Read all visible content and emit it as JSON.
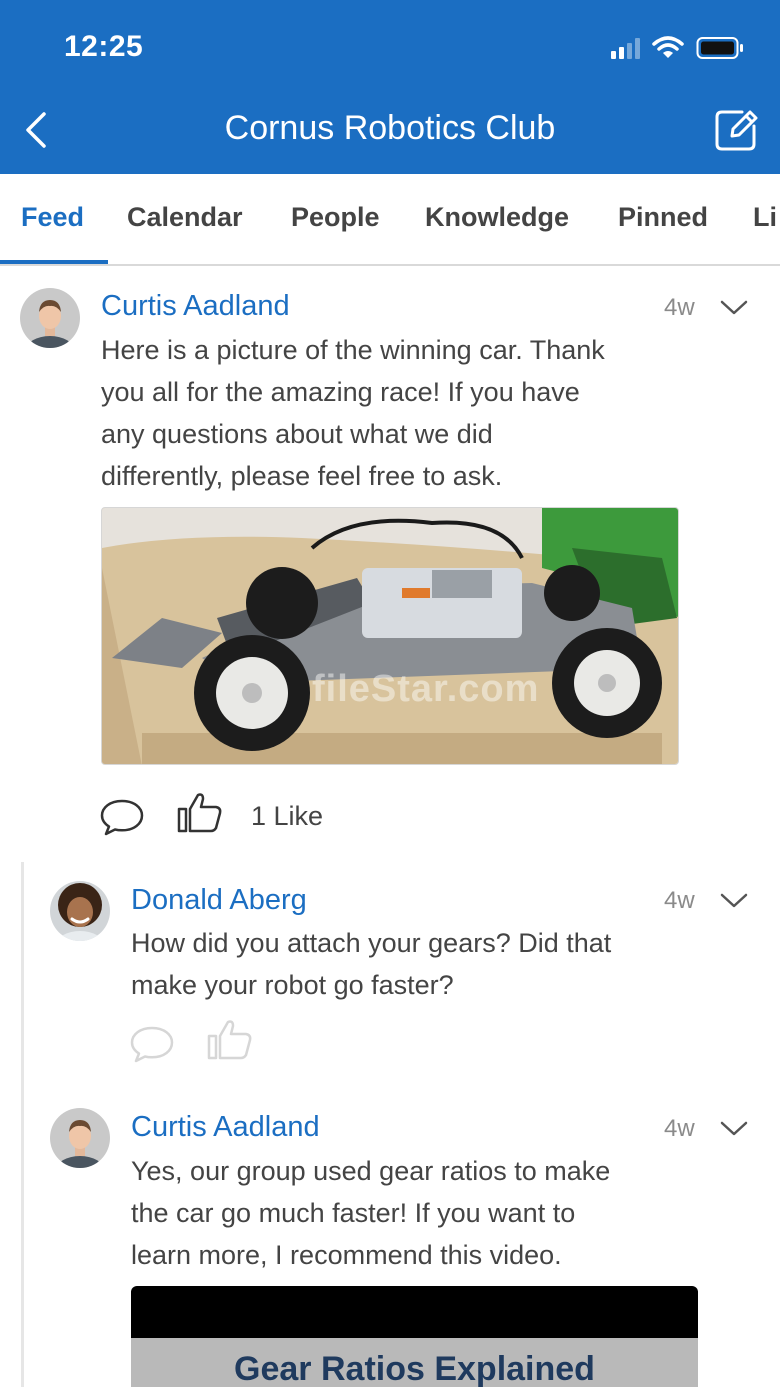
{
  "status_bar": {
    "time": "12:25"
  },
  "header": {
    "title": "Cornus Robotics Club",
    "back_icon": "chevron-left-icon",
    "compose_icon": "compose-icon"
  },
  "tabs": [
    {
      "label": "Feed",
      "active": true
    },
    {
      "label": "Calendar",
      "active": false
    },
    {
      "label": "People",
      "active": false
    },
    {
      "label": "Knowledge",
      "active": false
    },
    {
      "label": "Pinned",
      "active": false
    },
    {
      "label": "Li",
      "active": false
    }
  ],
  "post": {
    "author": "Curtis Aadland",
    "age": "4w",
    "lines": [
      "Here is a picture of the winning car. Thank",
      "you all for the amazing race! If you have",
      "any questions about what we did",
      "differently, please feel free to ask."
    ],
    "image_watermark": "fileStar.com",
    "likes_label": "1 Like"
  },
  "replies": [
    {
      "author": "Donald Aberg",
      "age": "4w",
      "lines": [
        "How did you attach your gears? Did that",
        "make your robot go faster?"
      ]
    },
    {
      "author": "Curtis Aadland",
      "age": "4w",
      "lines": [
        "Yes, our group used gear ratios to make",
        "the car go much faster! If you want to",
        "learn more, I recommend this video."
      ],
      "video_title": "Gear Ratios Explained"
    }
  ],
  "colors": {
    "accent": "#1b6ec2",
    "text": "#444444",
    "muted": "#8a8a8a"
  }
}
